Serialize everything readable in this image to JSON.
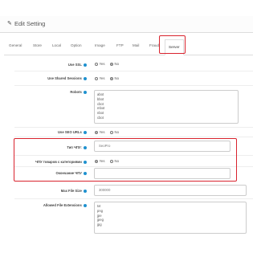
{
  "header": {
    "title": "Edit Setting"
  },
  "tabs": [
    "General",
    "Store",
    "Local",
    "Option",
    "Image",
    "FTP",
    "Mail",
    "Fraud",
    "Server"
  ],
  "active_tab": "Server",
  "fields": {
    "use_ssl": {
      "label": "Use SSL",
      "yes": "Yes",
      "no": "No",
      "selected": "No"
    },
    "shared_sessions": {
      "label": "Use Shared Sessions",
      "yes": "Yes",
      "no": "No",
      "selected": "No"
    },
    "robots": {
      "label": "Robots",
      "lines": [
        "abot",
        "bbot",
        "cbot",
        "mbot",
        "nbot",
        "cbot"
      ]
    },
    "seo_urls": {
      "label": "Use SEO URLs",
      "yes": "Yes",
      "no": "No",
      "selected": "Yes"
    },
    "seo_type": {
      "label": "Тип ЧПУ:",
      "value": "SeoPro"
    },
    "chpu_products": {
      "label": "ЧПУ товаров с категориями",
      "yes": "Yes",
      "no": "No",
      "selected": "Yes"
    },
    "chpu_ending": {
      "label": "Окончание ЧПУ",
      "value": ""
    },
    "max_file_size": {
      "label": "Max File Size",
      "value": "300000"
    },
    "allowed_ext": {
      "label": "Allowed File Extensions",
      "lines": [
        "txt",
        "png",
        "jpe",
        "jpeg",
        "jpg"
      ]
    }
  },
  "colors": {
    "highlight": "#d9232e",
    "help": "#1e91cf"
  },
  "icons": {
    "edit": "pencil-icon",
    "help": "question-circle-icon"
  }
}
